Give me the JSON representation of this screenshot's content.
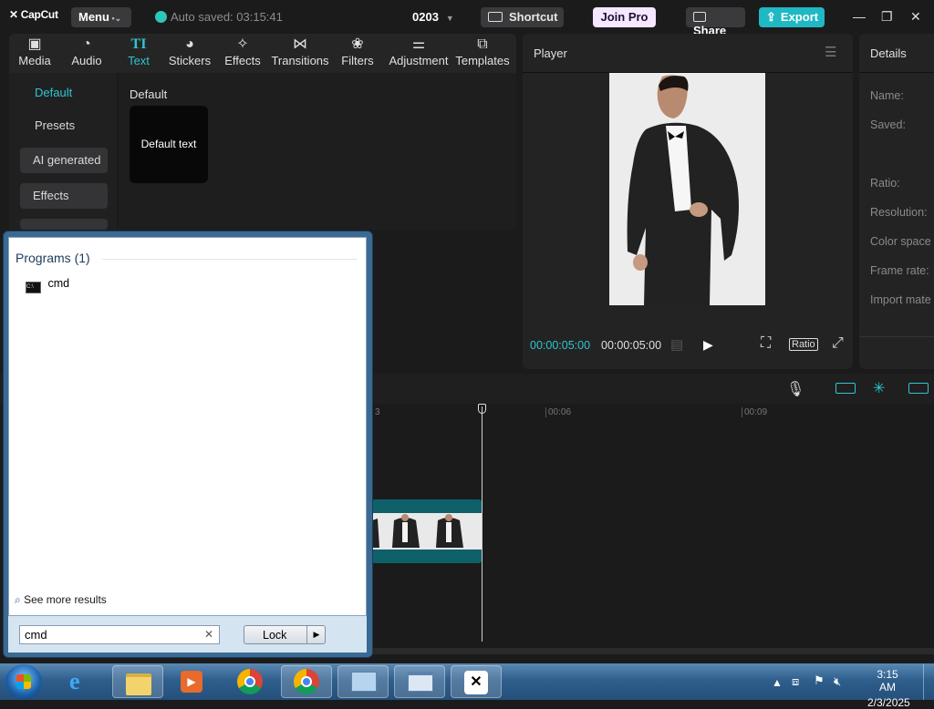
{
  "titlebar": {
    "logo": "CapCut",
    "menu_label": "Menu",
    "autosave": "Auto saved: 03:15:41",
    "project_name": "0203",
    "shortcut_label": "Shortcut",
    "joinpro_label": "Join Pro",
    "share_label": "Share",
    "export_label": "Export",
    "accent": "#1fb8c3"
  },
  "toolbar": {
    "tools": [
      {
        "label": "Media",
        "icon": "media-icon"
      },
      {
        "label": "Audio",
        "icon": "audio-icon"
      },
      {
        "label": "Text",
        "icon": "text-icon"
      },
      {
        "label": "Stickers",
        "icon": "stickers-icon"
      },
      {
        "label": "Effects",
        "icon": "effects-icon"
      },
      {
        "label": "Transitions",
        "icon": "transitions-icon"
      },
      {
        "label": "Filters",
        "icon": "filters-icon"
      },
      {
        "label": "Adjustment",
        "icon": "adjustment-icon"
      },
      {
        "label": "Templates",
        "icon": "templates-icon"
      }
    ],
    "active": "Text"
  },
  "left_categories": [
    "Default",
    "Presets",
    "AI generated",
    "Effects"
  ],
  "content": {
    "section_title": "Default",
    "card_label": "Default text"
  },
  "player": {
    "title": "Player",
    "current_time": "00:00:05:00",
    "total_time": "00:00:05:00",
    "ratio_label": "Ratio"
  },
  "details": {
    "title": "Details",
    "labels": [
      "Name:",
      "Saved:",
      "Ratio:",
      "Resolution:",
      "Color space",
      "Frame rate:",
      "Import mate"
    ]
  },
  "timeline": {
    "ticks": [
      "00:06",
      "00:09"
    ],
    "partial_tick": "3"
  },
  "startmenu": {
    "programs_header": "Programs (1)",
    "result": "cmd",
    "see_more": "See more results",
    "search_value": "cmd",
    "lock_label": "Lock"
  },
  "taskbar": {
    "time": "3:15 AM",
    "date": "2/3/2025"
  }
}
